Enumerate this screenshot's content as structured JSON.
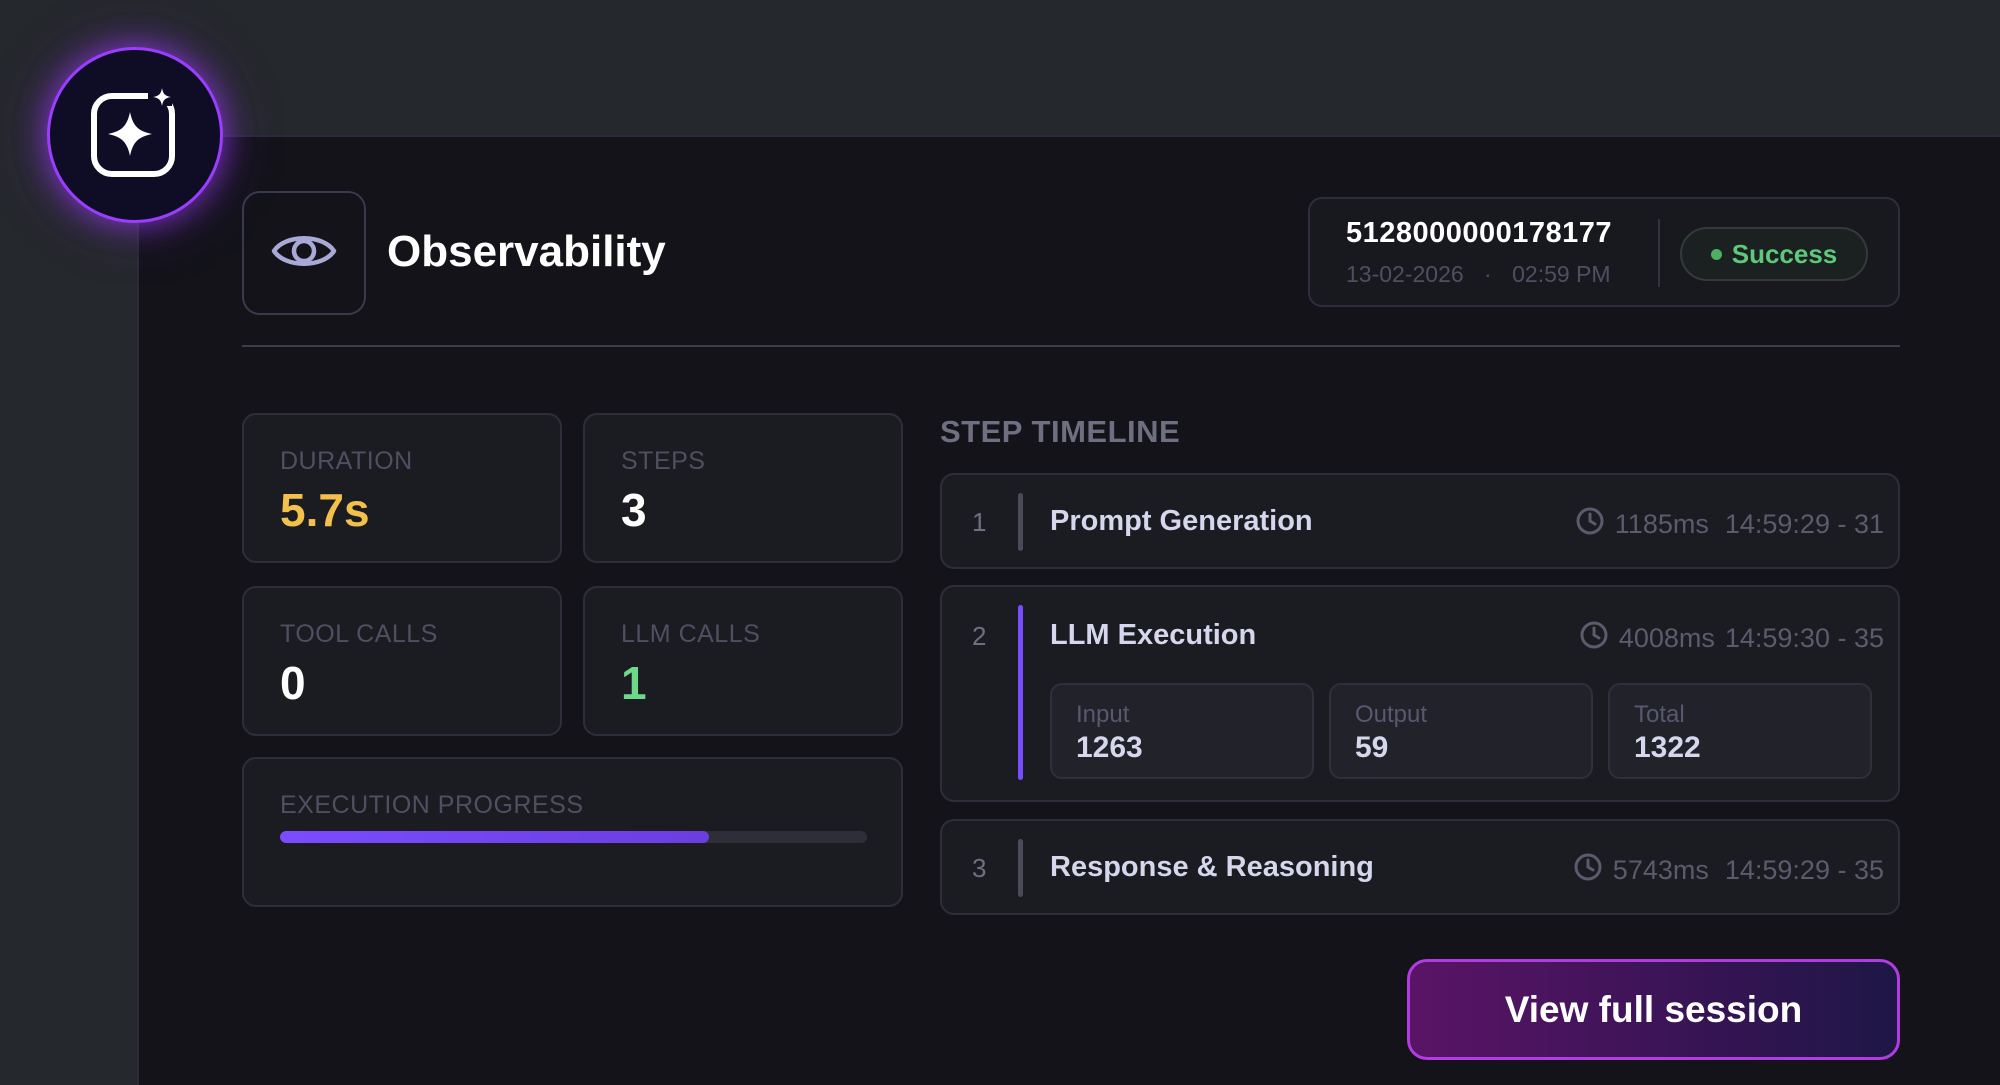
{
  "header": {
    "title": "Observability",
    "session": {
      "id": "5128000000178177",
      "date": "13-02-2026",
      "separator": "·",
      "time": "02:59 PM",
      "status": "Success",
      "status_color": "#5ec97a"
    }
  },
  "stats": {
    "duration": {
      "label": "DURATION",
      "value": "5.7s",
      "color": "#f3c04c"
    },
    "steps": {
      "label": "STEPS",
      "value": "3",
      "color": "#ffffff"
    },
    "tool_calls": {
      "label": "TOOL CALLS",
      "value": "0",
      "color": "#ffffff"
    },
    "llm_calls": {
      "label": "LLM CALLS",
      "value": "1",
      "color": "#6fd98a"
    }
  },
  "progress": {
    "label": "EXECUTION PROGRESS",
    "fraction": 0.73,
    "color": "#7a4cff"
  },
  "timeline": {
    "heading": "STEP TIMELINE",
    "steps": [
      {
        "num": "1",
        "name": "Prompt Generation",
        "ms": "1185ms",
        "range": "14:59:29 - 31"
      },
      {
        "num": "2",
        "name": "LLM Execution",
        "ms": "4008ms",
        "range": "14:59:30 - 35",
        "tokens": [
          {
            "label": "Input",
            "value": "1263"
          },
          {
            "label": "Output",
            "value": "59"
          },
          {
            "label": "Total",
            "value": "1322"
          }
        ]
      },
      {
        "num": "3",
        "name": "Response & Reasoning",
        "ms": "5743ms",
        "range": "14:59:29 - 35"
      }
    ]
  },
  "actions": {
    "view_session": "View full session"
  },
  "icons": {
    "badge": "sparkle-icon",
    "header": "eye-icon",
    "time": "clock-icon"
  },
  "colors": {
    "accent": "#7a4cff",
    "badge_glow": "#9b3dff",
    "button_border": "#b13de0"
  }
}
